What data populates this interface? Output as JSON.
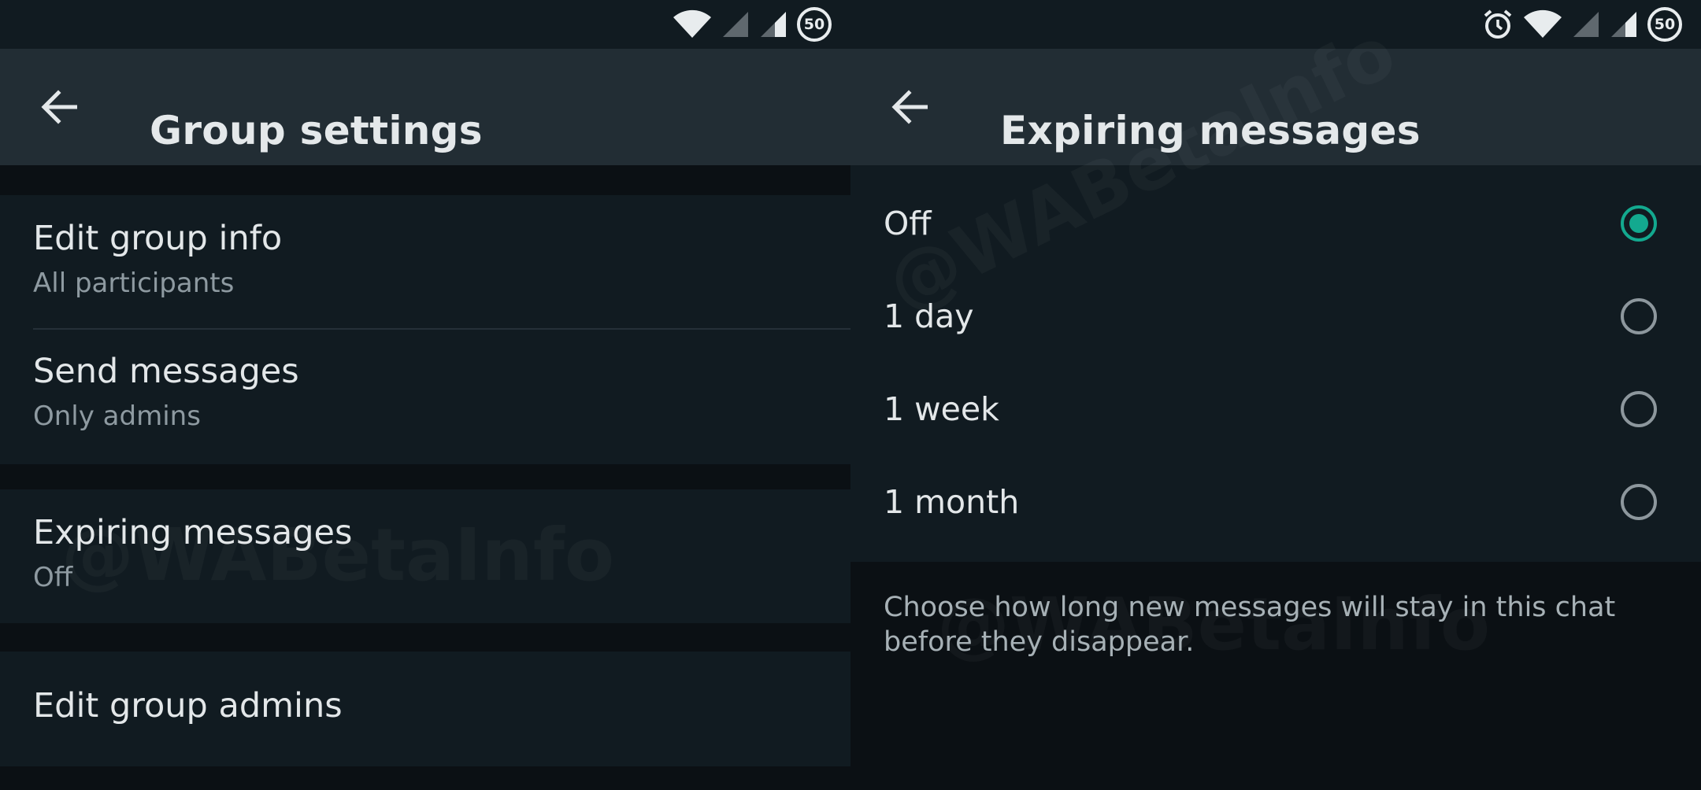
{
  "left_screen": {
    "status_bar": {
      "icons": [
        "wifi-icon",
        "cell-signal-icon",
        "cell-signal-icon",
        "battery-saver-icon"
      ],
      "battery_level": "50"
    },
    "app_bar": {
      "title": "Group settings",
      "back_icon": "arrow-back-icon"
    },
    "settings": [
      {
        "title": "Edit group info",
        "subtitle": "All participants"
      },
      {
        "title": "Send messages",
        "subtitle": "Only admins"
      },
      {
        "title": "Expiring messages",
        "subtitle": "Off"
      },
      {
        "title": "Edit group admins"
      }
    ],
    "watermark": "@WABetaInfo"
  },
  "right_screen": {
    "status_bar": {
      "icons": [
        "alarm-icon",
        "wifi-icon",
        "cell-signal-icon",
        "cell-signal-icon",
        "battery-saver-icon"
      ],
      "battery_level": "50"
    },
    "app_bar": {
      "title": "Expiring messages",
      "back_icon": "arrow-back-icon"
    },
    "options": [
      {
        "label": "Off",
        "selected": true
      },
      {
        "label": "1 day",
        "selected": false
      },
      {
        "label": "1 week",
        "selected": false
      },
      {
        "label": "1 month",
        "selected": false
      }
    ],
    "description": "Choose how long new messages will stay in this chat before they disappear.",
    "watermark": "@WABetaInfo"
  },
  "colors": {
    "accent": "#13a98f",
    "app_bar": "#222d34",
    "surface": "#111b21",
    "background": "#0b1014"
  }
}
